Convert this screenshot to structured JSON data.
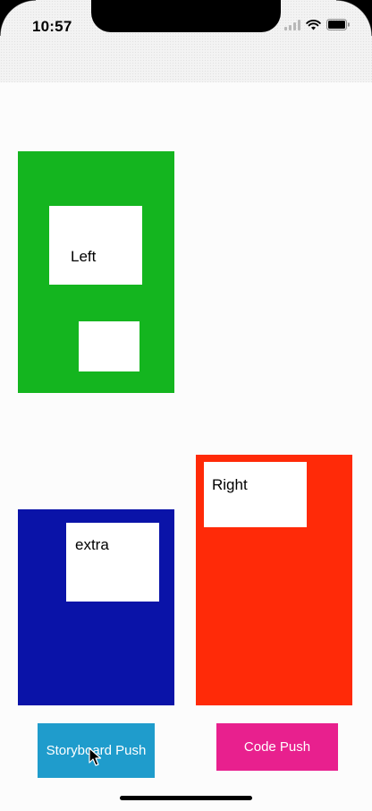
{
  "status_bar": {
    "time": "10:57",
    "icons": [
      "signal-icon",
      "wifi-icon",
      "battery-icon"
    ]
  },
  "colors": {
    "green_box": "#14b51f",
    "blue_box": "#0a13a8",
    "red_box": "#ff2a08",
    "storyboard_button": "#1f9ccc",
    "code_button": "#e8208e"
  },
  "views": {
    "left_label": "Left",
    "extra_label": "extra",
    "right_label": "Right"
  },
  "buttons": {
    "storyboard_push": "Storyboard Push",
    "code_push": "Code Push"
  }
}
